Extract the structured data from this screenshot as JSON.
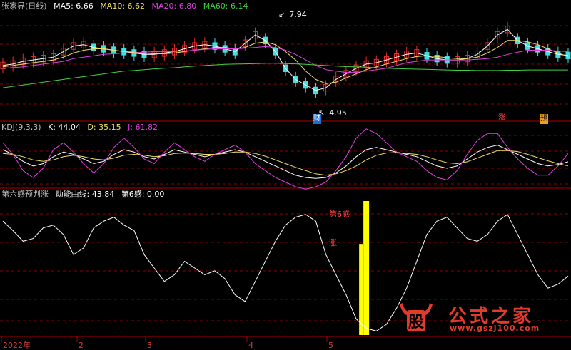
{
  "panel1": {
    "name": "张家界(日线)",
    "ma5": {
      "label": "MA5: 6.66",
      "color": "#ffffff"
    },
    "ma10": {
      "label": "MA10: 6.62",
      "color": "#f0e060"
    },
    "ma20": {
      "label": "MA20: 6.80",
      "color": "#e040e0"
    },
    "ma60": {
      "label": "MA60: 6.14",
      "color": "#40d040"
    },
    "high_label": "7.94",
    "low_label": "4.95",
    "marker_cai": "财",
    "marker_zhang": "涨",
    "marker_yu": "预"
  },
  "panel2": {
    "name": "KDJ(9,3,3)",
    "k": {
      "label": "K: 44.04",
      "color": "#ffffff"
    },
    "d": {
      "label": "D: 35.15",
      "color": "#f0e060"
    },
    "j": {
      "label": "J: 61.82",
      "color": "#e040e0"
    }
  },
  "panel3": {
    "name": "第六感预判涨",
    "curve": {
      "label": "动能曲线: 43.84",
      "color": "#ffffff"
    },
    "sixth": {
      "label": "第6感: 0.00",
      "color": "#ffffff"
    },
    "bar_label_1": "第6感",
    "bar_label_2": "涨"
  },
  "axis": {
    "ticks": [
      "2022年",
      "2",
      "3",
      "4",
      "5"
    ]
  },
  "watermark": {
    "logo_char": "股",
    "title": "公式之家",
    "url": "www.gszj100.com"
  },
  "colors": {
    "up": "#e03030",
    "down": "#40e0e0",
    "grid": "#8b0000",
    "bar": "#ffff00"
  },
  "chart_data": [
    {
      "type": "candlestick",
      "title": "张家界(日线)",
      "ylim": [
        4.5,
        8.3
      ],
      "series": [
        {
          "name": "MA5",
          "values": [
            6.3,
            6.35,
            6.45,
            6.5,
            6.55,
            6.6,
            6.8,
            7.0,
            7.05,
            6.95,
            6.9,
            6.85,
            6.8,
            6.75,
            6.7,
            6.7,
            6.75,
            6.8,
            6.9,
            7.0,
            7.05,
            7.0,
            6.9,
            6.8,
            7.1,
            7.4,
            7.2,
            6.8,
            6.2,
            5.8,
            5.6,
            5.4,
            5.5,
            5.8,
            6.0,
            6.2,
            6.35,
            6.4,
            6.5,
            6.6,
            6.7,
            6.75,
            6.65,
            6.55,
            6.5,
            6.5,
            6.55,
            6.7,
            7.0,
            7.4,
            7.6,
            7.2,
            7.0,
            6.9,
            6.8,
            6.7,
            6.66
          ]
        },
        {
          "name": "MA10",
          "values": [
            6.25,
            6.3,
            6.35,
            6.4,
            6.45,
            6.5,
            6.6,
            6.75,
            6.85,
            6.9,
            6.9,
            6.85,
            6.8,
            6.78,
            6.75,
            6.72,
            6.72,
            6.75,
            6.8,
            6.85,
            6.9,
            6.95,
            6.95,
            6.9,
            6.95,
            7.1,
            7.15,
            7.05,
            6.8,
            6.5,
            6.1,
            5.8,
            5.65,
            5.7,
            5.85,
            6.0,
            6.15,
            6.25,
            6.35,
            6.45,
            6.55,
            6.62,
            6.65,
            6.62,
            6.58,
            6.55,
            6.55,
            6.6,
            6.75,
            6.95,
            7.2,
            7.2,
            7.15,
            7.05,
            6.9,
            6.75,
            6.62
          ]
        },
        {
          "name": "MA20",
          "values": [
            6.2,
            6.22,
            6.25,
            6.3,
            6.35,
            6.4,
            6.45,
            6.55,
            6.6,
            6.65,
            6.7,
            6.72,
            6.75,
            6.75,
            6.78,
            6.8,
            6.8,
            6.8,
            6.82,
            6.85,
            6.88,
            6.9,
            6.9,
            6.9,
            6.92,
            6.95,
            6.98,
            6.95,
            6.85,
            6.7,
            6.5,
            6.3,
            6.15,
            6.1,
            6.05,
            6.05,
            6.1,
            6.15,
            6.2,
            6.3,
            6.4,
            6.45,
            6.5,
            6.5,
            6.5,
            6.5,
            6.5,
            6.52,
            6.55,
            6.6,
            6.7,
            6.78,
            6.85,
            6.85,
            6.85,
            6.82,
            6.8
          ]
        },
        {
          "name": "MA60",
          "values": [
            5.5,
            5.55,
            5.6,
            5.65,
            5.7,
            5.75,
            5.8,
            5.85,
            5.9,
            5.95,
            6.0,
            6.05,
            6.1,
            6.12,
            6.15,
            6.18,
            6.2,
            6.22,
            6.25,
            6.28,
            6.3,
            6.32,
            6.34,
            6.35,
            6.36,
            6.37,
            6.38,
            6.38,
            6.37,
            6.36,
            6.34,
            6.32,
            6.3,
            6.28,
            6.26,
            6.25,
            6.24,
            6.22,
            6.2,
            6.19,
            6.18,
            6.17,
            6.16,
            6.15,
            6.14,
            6.13,
            6.13,
            6.12,
            6.12,
            6.12,
            6.13,
            6.13,
            6.14,
            6.14,
            6.14,
            6.14,
            6.14
          ]
        }
      ]
    },
    {
      "type": "line",
      "title": "KDJ(9,3,3)",
      "ylim": [
        -10,
        110
      ],
      "series": [
        {
          "name": "K",
          "values": [
            70,
            60,
            45,
            35,
            40,
            55,
            65,
            60,
            50,
            40,
            45,
            60,
            70,
            65,
            55,
            50,
            60,
            70,
            65,
            60,
            55,
            60,
            65,
            70,
            65,
            55,
            45,
            35,
            25,
            15,
            10,
            8,
            10,
            20,
            35,
            55,
            70,
            75,
            70,
            65,
            60,
            55,
            45,
            35,
            30,
            35,
            50,
            65,
            75,
            80,
            70,
            60,
            50,
            40,
            35,
            38,
            44
          ]
        },
        {
          "name": "D",
          "values": [
            62,
            60,
            55,
            48,
            45,
            48,
            55,
            58,
            55,
            50,
            48,
            52,
            58,
            60,
            58,
            55,
            57,
            62,
            63,
            62,
            60,
            60,
            62,
            65,
            65,
            62,
            56,
            48,
            40,
            32,
            25,
            18,
            15,
            18,
            25,
            35,
            48,
            58,
            63,
            64,
            62,
            60,
            55,
            48,
            42,
            40,
            44,
            52,
            60,
            68,
            68,
            66,
            60,
            53,
            46,
            40,
            35
          ]
        },
        {
          "name": "J",
          "values": [
            85,
            60,
            25,
            10,
            30,
            70,
            85,
            65,
            40,
            20,
            40,
            75,
            95,
            75,
            50,
            40,
            65,
            85,
            70,
            55,
            45,
            60,
            70,
            80,
            65,
            40,
            25,
            10,
            0,
            -10,
            -15,
            -10,
            0,
            25,
            55,
            95,
            115,
            105,
            85,
            65,
            55,
            45,
            25,
            10,
            5,
            25,
            60,
            90,
            105,
            105,
            75,
            50,
            30,
            15,
            15,
            35,
            61.82
          ]
        }
      ]
    },
    {
      "type": "line",
      "title": "第六感预判涨",
      "ylim": [
        0,
        100
      ],
      "series": [
        {
          "name": "动能曲线",
          "values": [
            85,
            78,
            70,
            72,
            80,
            82,
            75,
            60,
            65,
            80,
            85,
            88,
            82,
            78,
            60,
            50,
            40,
            45,
            55,
            50,
            45,
            48,
            42,
            30,
            25,
            40,
            55,
            70,
            82,
            88,
            90,
            85,
            60,
            45,
            30,
            12,
            5,
            3,
            8,
            20,
            35,
            55,
            75,
            85,
            88,
            80,
            72,
            70,
            75,
            85,
            90,
            75,
            60,
            45,
            35,
            38,
            44
          ]
        },
        {
          "name": "第6感",
          "values": [
            0,
            0,
            0,
            0,
            0,
            0,
            0,
            0,
            0,
            0,
            0,
            0,
            0,
            0,
            0,
            0,
            0,
            0,
            0,
            0,
            0,
            0,
            0,
            0,
            0,
            0,
            0,
            0,
            0,
            0,
            0,
            0,
            0,
            0,
            0,
            0,
            100,
            0,
            0,
            0,
            0,
            0,
            0,
            0,
            0,
            0,
            0,
            0,
            0,
            0,
            0,
            0,
            0,
            0,
            0,
            0,
            0
          ]
        }
      ]
    }
  ]
}
